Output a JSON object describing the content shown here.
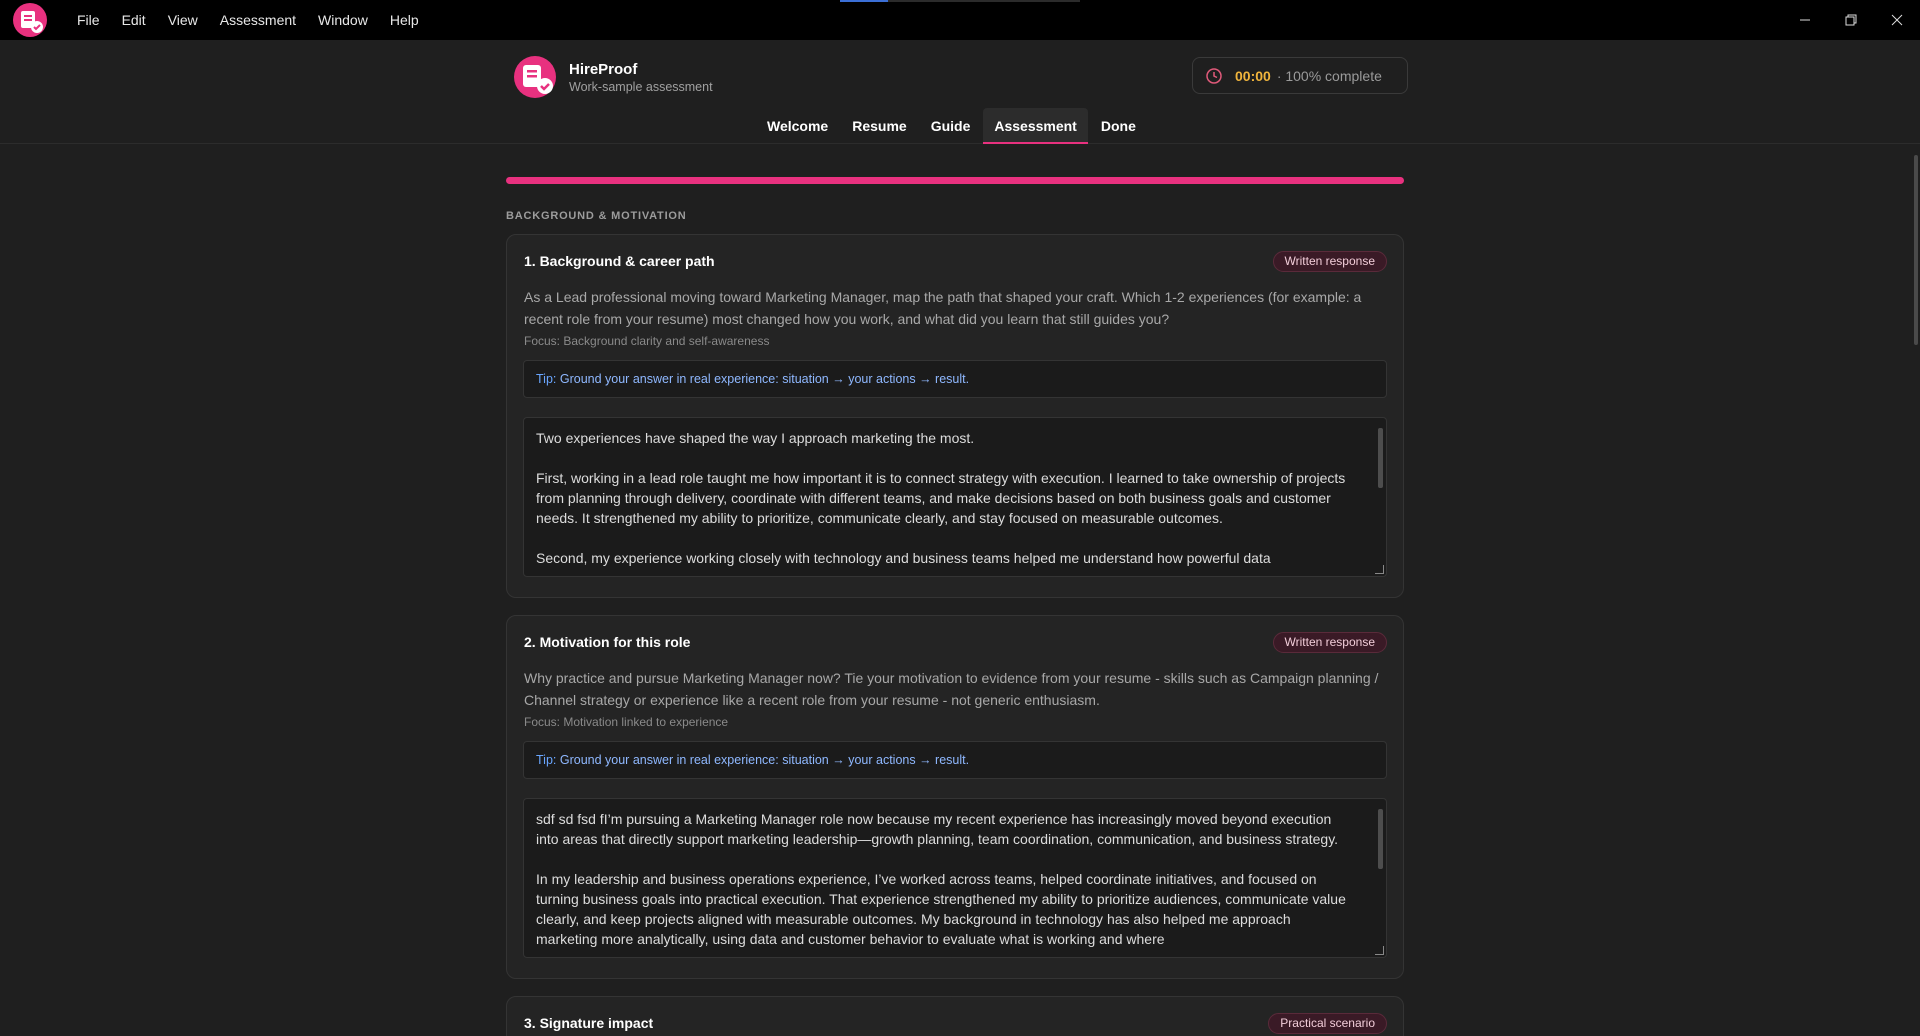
{
  "menu": [
    "File",
    "Edit",
    "View",
    "Assessment",
    "Window",
    "Help"
  ],
  "window_controls": [
    "minimize-icon",
    "restore-icon",
    "close-icon"
  ],
  "brand": {
    "name": "HireProof",
    "subtitle": "Work-sample assessment"
  },
  "timer": {
    "value": "00:00",
    "progress": "· 100% complete"
  },
  "nav_tabs": [
    "Welcome",
    "Resume",
    "Guide",
    "Assessment",
    "Done"
  ],
  "active_tab": "Assessment",
  "progress_fraction": 1.0,
  "colors": {
    "accent": "#e8317f",
    "timer": "#f0b43c",
    "tip": "#6aa6ff"
  },
  "section_label": "BACKGROUND & MOTIVATION",
  "questions": [
    {
      "title": "1. Background & career path",
      "badge": "Written response",
      "prompt": "As a Lead professional moving toward Marketing Manager, map the path that shaped your craft. Which 1-2 experiences (for example: a recent role from your resume) most changed how you work, and what did you learn that still guides you?",
      "focus": "Focus: Background clarity and self-awareness",
      "tip_label": "Tip:",
      "tip_text": "Ground your answer in real experience: situation → your actions → result.",
      "answer": [
        "Two experiences have shaped the way I approach marketing the most.",
        "First, working in a lead role taught me how important it is to connect strategy with execution. I learned to take ownership of projects from planning through delivery, coordinate with different teams, and make decisions based on both business goals and customer needs. It strengthened my ability to prioritize, communicate clearly, and stay focused on measurable outcomes.",
        "Second, my experience working closely with technology and business teams helped me understand how powerful data"
      ]
    },
    {
      "title": "2. Motivation for this role",
      "badge": "Written response",
      "prompt": "Why practice and pursue Marketing Manager now? Tie your motivation to evidence from your resume - skills such as Campaign planning / Channel strategy or experience like a recent role from your resume - not generic enthusiasm.",
      "focus": "Focus: Motivation linked to experience",
      "tip_label": "Tip:",
      "tip_text": "Ground your answer in real experience: situation → your actions → result.",
      "answer": [
        "sdf sd fsd fI’m pursuing a Marketing Manager role now because my recent experience has increasingly moved beyond execution into areas that directly support marketing leadership—growth planning, team coordination, communication, and business strategy.",
        "In my leadership and business operations experience, I’ve worked across teams, helped coordinate initiatives, and focused on turning business goals into practical execution. That experience strengthened my ability to prioritize audiences, communicate value clearly, and keep projects aligned with measurable outcomes. My background in technology has also helped me approach marketing more analytically, using data and customer behavior to evaluate what is working and where"
      ]
    },
    {
      "title": "3. Signature impact",
      "badge": "Practical scenario"
    }
  ]
}
